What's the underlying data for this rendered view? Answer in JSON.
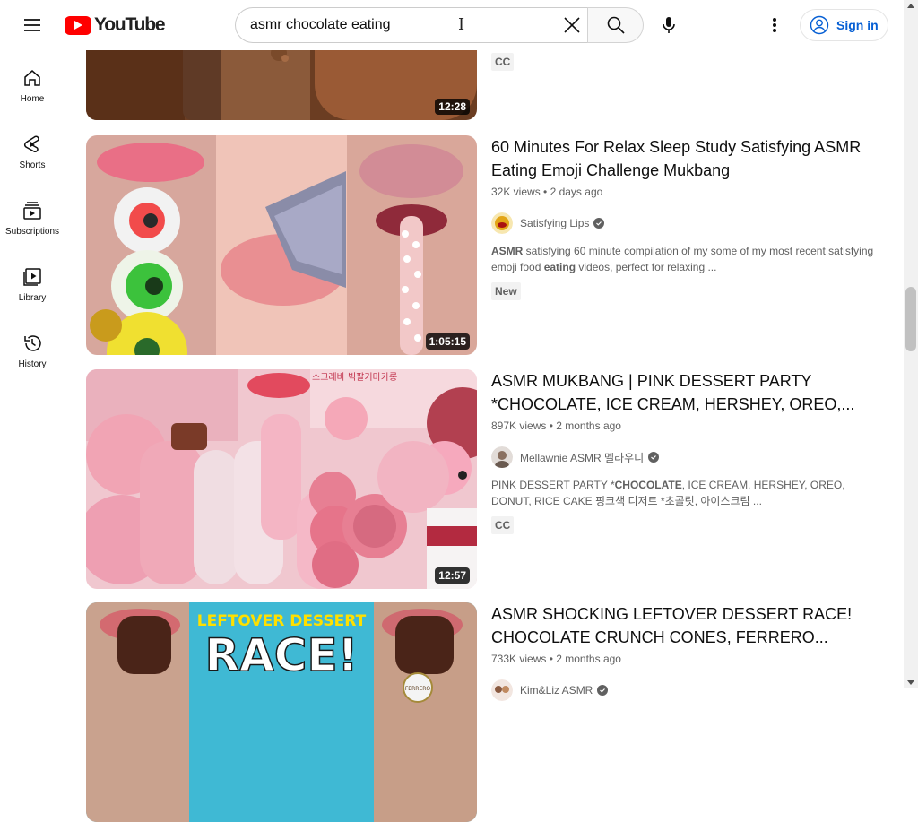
{
  "header": {
    "logo_text": "YouTube",
    "search_query": "asmr chocolate eating",
    "signin_label": "Sign in"
  },
  "sidebar": {
    "items": [
      {
        "label": "Home",
        "icon": "home-icon"
      },
      {
        "label": "Shorts",
        "icon": "shorts-icon"
      },
      {
        "label": "Subscriptions",
        "icon": "subscriptions-icon"
      },
      {
        "label": "Library",
        "icon": "library-icon"
      },
      {
        "label": "History",
        "icon": "history-icon"
      }
    ]
  },
  "results": [
    {
      "duration": "12:28",
      "badge": "CC"
    },
    {
      "title": "60 Minutes For Relax Sleep Study Satisfying ASMR Eating Emoji Challenge Mukbang",
      "views": "32K views",
      "age": "2 days ago",
      "channel": "Satisfying Lips",
      "snippet_bold_1": "ASMR",
      "snippet_mid": " satisfying 60 minute compilation of my some of my most recent satisfying emoji food ",
      "snippet_bold_2": "eating",
      "snippet_end": " videos, perfect for relaxing ...",
      "badge": "New",
      "duration": "1:05:15"
    },
    {
      "title": "ASMR MUKBANG | PINK DESSERT PARTY *CHOCOLATE, ICE CREAM, HERSHEY, OREO,...",
      "views": "897K views",
      "age": "2 months ago",
      "channel": "Mellawnie ASMR 멜라우니",
      "snippet_pre": "PINK DESSERT PARTY *",
      "snippet_bold": "CHOCOLATE",
      "snippet_post": ", ICE CREAM, HERSHEY, OREO, DONUT, RICE CAKE 핑크색 디저트 *초콜릿, 아이스크림 ...",
      "badge": "CC",
      "duration": "12:57",
      "thumb_text": "스크레바 빅팔기마카롱"
    },
    {
      "title": "ASMR SHOCKING LEFTOVER DESSERT RACE! CHOCOLATE CRUNCH CONES, FERRERO...",
      "views": "733K views",
      "age": "2 months ago",
      "channel": "Kim&Liz ASMR",
      "thumb_line1": "LEFTOVER DESSERT",
      "thumb_line2": "RACE!",
      "thumb_brand": "FERRERO"
    }
  ],
  "colors": {
    "brand_red": "#ff0000",
    "link_blue": "#065fd4",
    "secondary_text": "#606060"
  }
}
